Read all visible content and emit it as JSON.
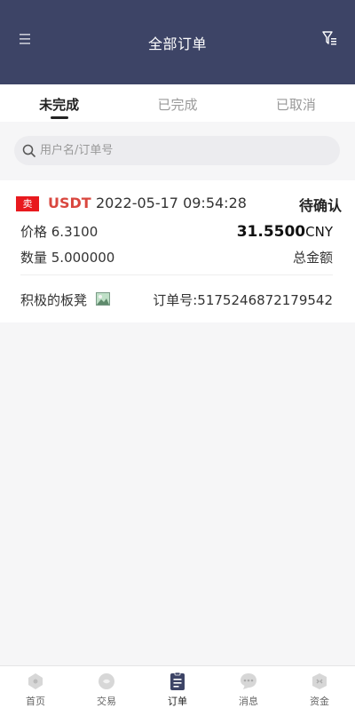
{
  "header": {
    "title": "全部订单",
    "menu_icon": "menu-icon",
    "filter_icon": "filter-icon"
  },
  "tabs": [
    {
      "label": "未完成",
      "active": true
    },
    {
      "label": "已完成",
      "active": false
    },
    {
      "label": "已取消",
      "active": false
    }
  ],
  "search": {
    "placeholder": "用户名/订单号",
    "value": ""
  },
  "order": {
    "side": "卖",
    "coin": "USDT",
    "datetime": "2022-05-17 09:54:28",
    "status": "待确认",
    "price": "价格 6.3100",
    "total_amount": "31.5500",
    "currency": "CNY",
    "quantity": "数量 5.000000",
    "total_label": "总金额",
    "nickname": "积极的板凳",
    "order_number": "订单号:517524687217954​2"
  },
  "bottom_nav": [
    {
      "label": "首页",
      "icon": "home-icon",
      "active": false
    },
    {
      "label": "交易",
      "icon": "trade-icon",
      "active": false
    },
    {
      "label": "订单",
      "icon": "order-icon",
      "active": true
    },
    {
      "label": "消息",
      "icon": "message-icon",
      "active": false
    },
    {
      "label": "资金",
      "icon": "wallet-icon",
      "active": false
    }
  ],
  "colors": {
    "header_bg": "#3d4466",
    "sell_badge": "#e8191e",
    "coin_text": "#d9473f"
  }
}
